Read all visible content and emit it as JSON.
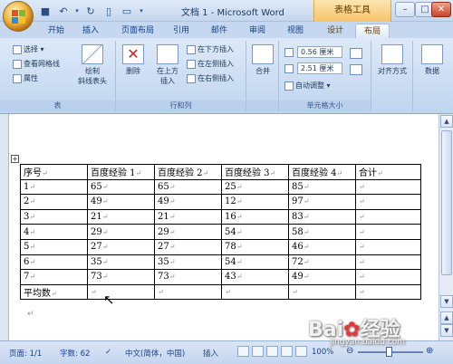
{
  "window": {
    "title": "文档 1 - Microsoft Word",
    "context_tab": "表格工具",
    "min": "–",
    "max": "□",
    "close": "✕"
  },
  "tabs": [
    "开始",
    "插入",
    "页面布局",
    "引用",
    "邮件",
    "审阅",
    "视图",
    "设计",
    "布局"
  ],
  "active_tab": "布局",
  "ribbon": {
    "group_table": {
      "label": "表",
      "select": "选择 ▾",
      "gridlines": "查看网格线",
      "properties": "属性",
      "draw_diag": "绘制\n斜线表头"
    },
    "group_rowcol": {
      "label": "行和列",
      "delete": "删除",
      "insert_above": "在上方\n插入",
      "insert_below": "在下方插入",
      "insert_left": "在左侧插入",
      "insert_right": "在右侧插入"
    },
    "group_merge": {
      "label": "",
      "merge": "合并"
    },
    "group_cellsize": {
      "label": "单元格大小",
      "height": "0.56 厘米",
      "width": "2.51 厘米",
      "autofit": "自动调整 ▾"
    },
    "group_align": {
      "align": "对齐方式"
    },
    "group_data": {
      "data": "数据"
    }
  },
  "table": {
    "rows": [
      [
        "序号",
        "百度经验 1",
        "百度经验 2",
        "百度经验 3",
        "百度经验 4",
        "合计"
      ],
      [
        "1",
        "65",
        "65",
        "25",
        "85",
        ""
      ],
      [
        "2",
        "49",
        "49",
        "12",
        "97",
        ""
      ],
      [
        "3",
        "21",
        "21",
        "16",
        "83",
        ""
      ],
      [
        "4",
        "29",
        "29",
        "54",
        "58",
        ""
      ],
      [
        "5",
        "27",
        "27",
        "78",
        "46",
        ""
      ],
      [
        "6",
        "35",
        "35",
        "54",
        "72",
        ""
      ],
      [
        "7",
        "73",
        "73",
        "43",
        "49",
        ""
      ],
      [
        "平均数",
        "",
        "",
        "",
        "",
        ""
      ]
    ],
    "cell_mark": "↵"
  },
  "status": {
    "page": "页面: 1/1",
    "words": "字数: 62",
    "lang": "中文(简体，中国)",
    "mode": "插入",
    "zoom": "100%"
  },
  "watermark": {
    "text": "Bai du 经验",
    "url": "jingyan.baidu.com"
  }
}
